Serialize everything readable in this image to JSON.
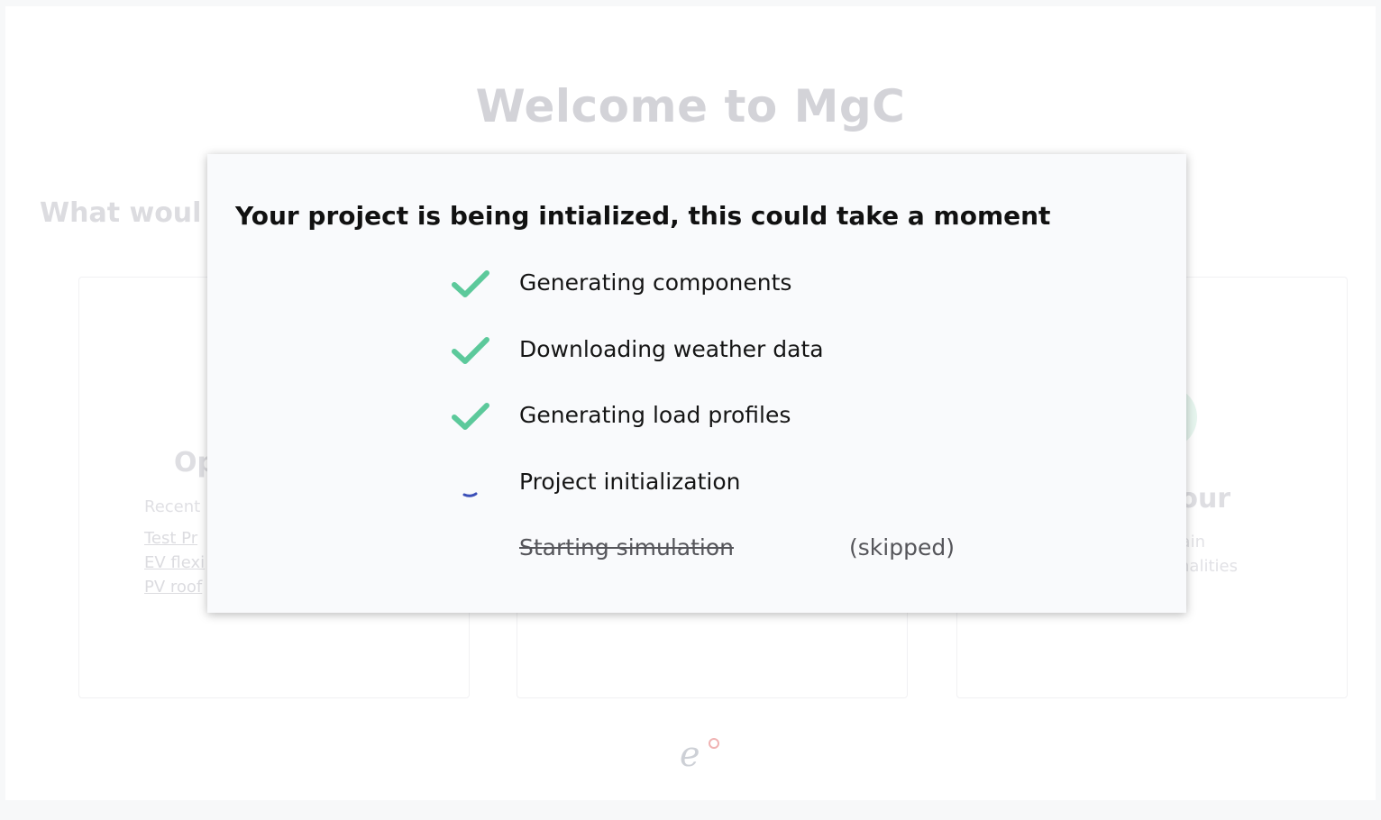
{
  "background": {
    "title": "Welcome to MgC",
    "subtitle": "What woul",
    "cards": [
      {
        "heading": "Op",
        "recent_label": "Recent",
        "links": [
          "Test Pr",
          "EV flexi",
          "PV roof"
        ]
      },
      {
        "heading": "tour",
        "desc_lines": [
          "main",
          "ionalities"
        ]
      }
    ],
    "logo_text": "e"
  },
  "modal": {
    "title": "Your project is being intialized, this could take a moment",
    "steps": [
      {
        "label": "Generating components",
        "state": "done",
        "icon": "check-icon"
      },
      {
        "label": "Downloading weather data",
        "state": "done",
        "icon": "check-icon"
      },
      {
        "label": "Generating load profiles",
        "state": "done",
        "icon": "check-icon"
      },
      {
        "label": "Project initialization",
        "state": "in-progress",
        "icon": "spinner-icon"
      },
      {
        "label": "Starting simulation",
        "state": "skipped",
        "status": "(skipped)"
      }
    ]
  },
  "colors": {
    "check": "#5cc99b",
    "spinner": "#3b4fb8"
  }
}
